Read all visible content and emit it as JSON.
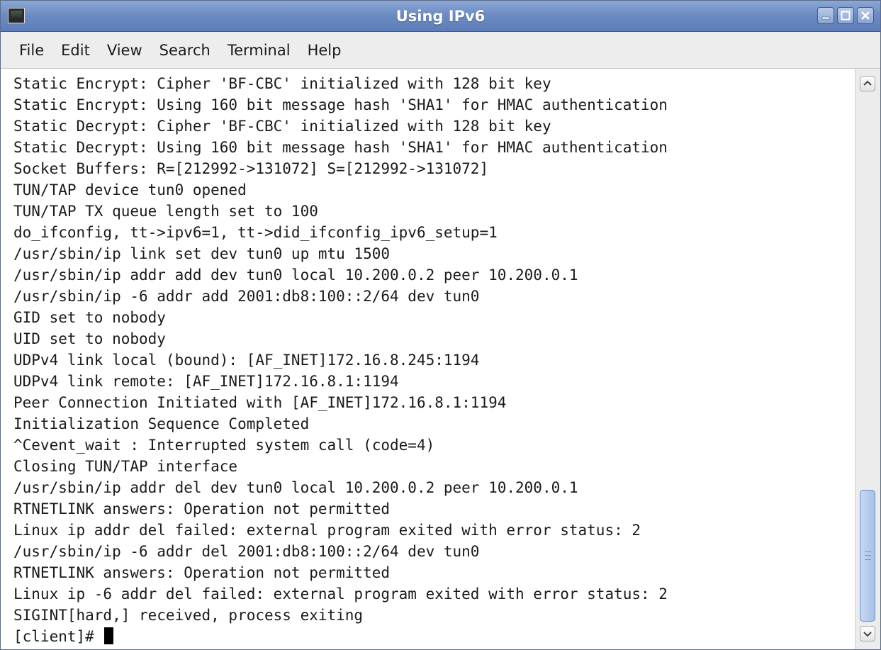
{
  "window": {
    "title": "Using IPv6",
    "icons": {
      "app": "terminal-icon",
      "minimize": "minimize-icon",
      "maximize": "maximize-icon",
      "close": "close-icon"
    },
    "colors": {
      "titlebar": "#6d8cc4",
      "menubar": "#ededed",
      "background": "#ffffff",
      "text": "#1a1a1a",
      "scroll_thumb": "#a8c0e8"
    }
  },
  "menu": {
    "items": [
      "File",
      "Edit",
      "View",
      "Search",
      "Terminal",
      "Help"
    ]
  },
  "terminal": {
    "lines": [
      "Static Encrypt: Cipher 'BF-CBC' initialized with 128 bit key",
      "Static Encrypt: Using 160 bit message hash 'SHA1' for HMAC authentication",
      "Static Decrypt: Cipher 'BF-CBC' initialized with 128 bit key",
      "Static Decrypt: Using 160 bit message hash 'SHA1' for HMAC authentication",
      "Socket Buffers: R=[212992->131072] S=[212992->131072]",
      "TUN/TAP device tun0 opened",
      "TUN/TAP TX queue length set to 100",
      "do_ifconfig, tt->ipv6=1, tt->did_ifconfig_ipv6_setup=1",
      "/usr/sbin/ip link set dev tun0 up mtu 1500",
      "/usr/sbin/ip addr add dev tun0 local 10.200.0.2 peer 10.200.0.1",
      "/usr/sbin/ip -6 addr add 2001:db8:100::2/64 dev tun0",
      "GID set to nobody",
      "UID set to nobody",
      "UDPv4 link local (bound): [AF_INET]172.16.8.245:1194",
      "UDPv4 link remote: [AF_INET]172.16.8.1:1194",
      "Peer Connection Initiated with [AF_INET]172.16.8.1:1194",
      "Initialization Sequence Completed",
      "^Cevent_wait : Interrupted system call (code=4)",
      "Closing TUN/TAP interface",
      "/usr/sbin/ip addr del dev tun0 local 10.200.0.2 peer 10.200.0.1",
      "RTNETLINK answers: Operation not permitted",
      "Linux ip addr del failed: external program exited with error status: 2",
      "/usr/sbin/ip -6 addr del 2001:db8:100::2/64 dev tun0",
      "RTNETLINK answers: Operation not permitted",
      "Linux ip -6 addr del failed: external program exited with error status: 2",
      "SIGINT[hard,] received, process exiting"
    ],
    "prompt": "[client]# "
  },
  "scrollbar": {
    "up_icon": "scroll-up-arrow-icon",
    "down_icon": "scroll-down-arrow-icon"
  }
}
